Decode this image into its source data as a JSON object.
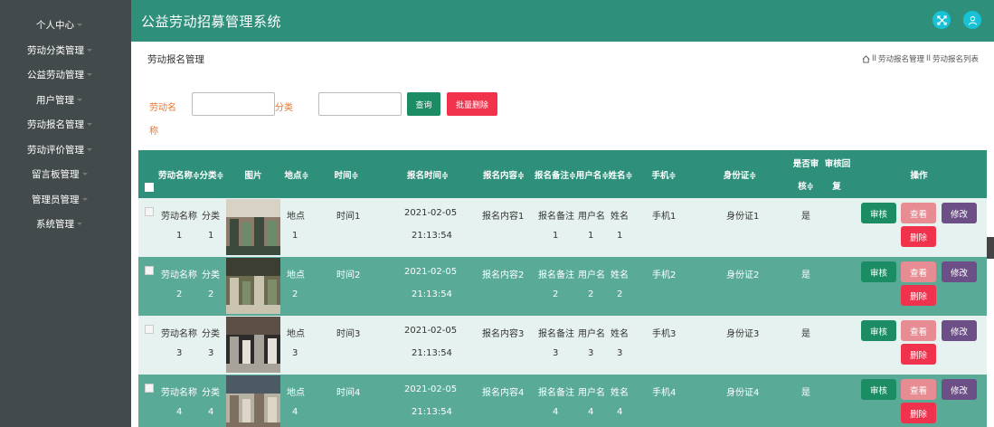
{
  "sidebar": {
    "items": [
      {
        "label": "个人中心"
      },
      {
        "label": "劳动分类管理"
      },
      {
        "label": "公益劳动管理"
      },
      {
        "label": "用户管理"
      },
      {
        "label": "劳动报名管理"
      },
      {
        "label": "劳动评价管理"
      },
      {
        "label": "留言板管理"
      },
      {
        "label": "管理员管理"
      },
      {
        "label": "系统管理"
      }
    ]
  },
  "header": {
    "title": "公益劳动招募管理系统",
    "colors": {
      "bar": "#2e8f7b",
      "icon_bg": "#17c2d6"
    },
    "icons": [
      "fullscreen-icon",
      "user-icon"
    ]
  },
  "page": {
    "title": "劳动报名管理",
    "breadcrumb": [
      "劳动报名管理",
      "劳动报名列表"
    ],
    "breadcrumb_sep": "II"
  },
  "search": {
    "name_label_line1": "劳动名",
    "name_label_line2": "称",
    "name_value": "",
    "category_label": "分类",
    "category_value": "",
    "query_button": "查询",
    "batch_delete_button": "批量删除"
  },
  "table": {
    "headers": {
      "name": "劳动名称≑",
      "category": "分类≑",
      "image": "图片",
      "location": "地点≑",
      "time": "时间≑",
      "signup_time": "报名时间≑",
      "signup_content": "报名内容≑",
      "signup_note": "报名备注≑",
      "username": "用户名≑",
      "realname": "姓名≑",
      "phone": "手机≑",
      "idcard": "身份证≑",
      "audit_line1": "是否审",
      "audit_line2": "核≑",
      "reply_line1": "审核回",
      "reply_line2": "复",
      "actions": "操作"
    },
    "rows": [
      {
        "name": "劳动名称",
        "name_n": "1",
        "category": "分类",
        "category_n": "1",
        "location": "地点",
        "location_n": "1",
        "time": "时间1",
        "signup_date": "2021-02-05",
        "signup_clock": "21:13:54",
        "content": "报名内容1",
        "note": "报名备注",
        "note_n": "1",
        "username": "用户名",
        "username_n": "1",
        "realname": "姓名",
        "realname_n": "1",
        "phone": "手机1",
        "idcard": "身份证1",
        "audited": "是",
        "reply": ""
      },
      {
        "name": "劳动名称",
        "name_n": "2",
        "category": "分类",
        "category_n": "2",
        "location": "地点",
        "location_n": "2",
        "time": "时间2",
        "signup_date": "2021-02-05",
        "signup_clock": "21:13:54",
        "content": "报名内容2",
        "note": "报名备注",
        "note_n": "2",
        "username": "用户名",
        "username_n": "2",
        "realname": "姓名",
        "realname_n": "2",
        "phone": "手机2",
        "idcard": "身份证2",
        "audited": "是",
        "reply": ""
      },
      {
        "name": "劳动名称",
        "name_n": "3",
        "category": "分类",
        "category_n": "3",
        "location": "地点",
        "location_n": "3",
        "time": "时间3",
        "signup_date": "2021-02-05",
        "signup_clock": "21:13:54",
        "content": "报名内容3",
        "note": "报名备注",
        "note_n": "3",
        "username": "用户名",
        "username_n": "3",
        "realname": "姓名",
        "realname_n": "3",
        "phone": "手机3",
        "idcard": "身份证3",
        "audited": "是",
        "reply": ""
      },
      {
        "name": "劳动名称",
        "name_n": "4",
        "category": "分类",
        "category_n": "4",
        "location": "地点",
        "location_n": "4",
        "time": "时间4",
        "signup_date": "2021-02-05",
        "signup_clock": "21:13:54",
        "content": "报名内容4",
        "note": "报名备注",
        "note_n": "4",
        "username": "用户名",
        "username_n": "4",
        "realname": "姓名",
        "realname_n": "4",
        "phone": "手机4",
        "idcard": "身份证4",
        "audited": "是",
        "reply": ""
      }
    ],
    "actions": {
      "audit": "审核",
      "view": "查看",
      "edit": "修改",
      "delete": "删除"
    },
    "colors": {
      "header": "#2e8f7b",
      "row_light": "#e6f2ef",
      "row_dark": "#5aaa98",
      "audit": "#1b8c64",
      "view": "#e88c93",
      "edit": "#6c4f86",
      "delete": "#f0324c"
    }
  }
}
